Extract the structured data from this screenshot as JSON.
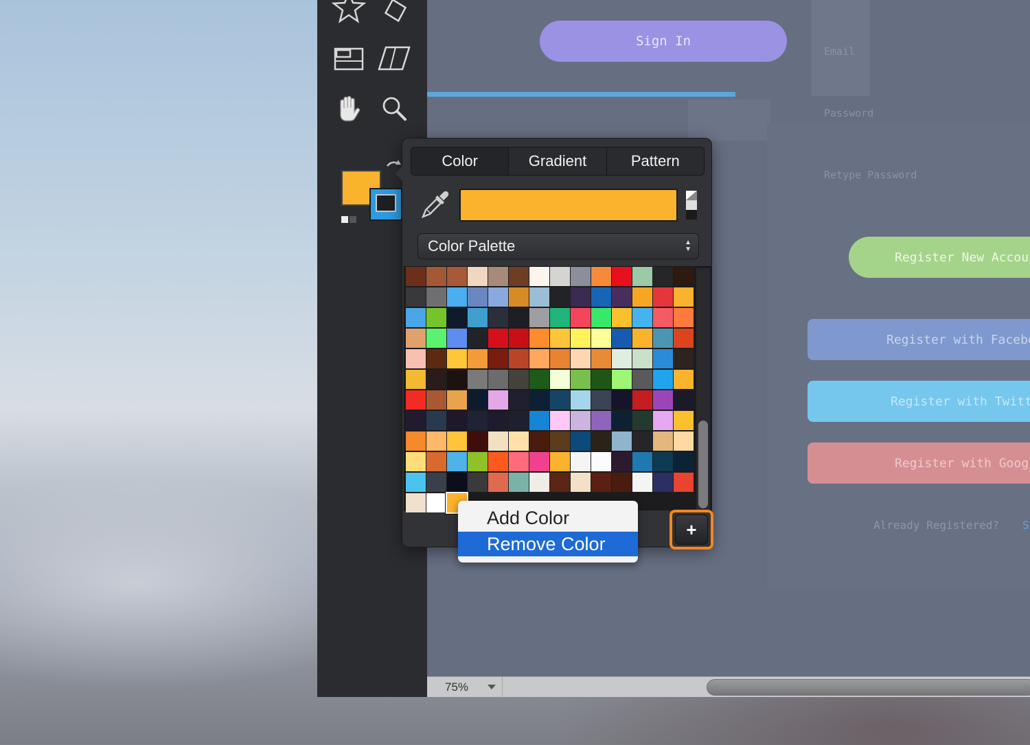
{
  "canvas_mockup": {
    "sign_in_label": "Sign In",
    "email_label": "Email",
    "password_label": "Password",
    "retype_password_label": "Retype Password",
    "register_new_account": "Register New Account",
    "register_facebook": "Register with Facebook",
    "register_twitter": "Register with Twitter",
    "register_google": "Register with Google",
    "already_registered": "Already Registered?",
    "sign_in_link": "S"
  },
  "status_bar": {
    "zoom": "75%"
  },
  "tools": [
    {
      "icon": "star-tool-icon"
    },
    {
      "icon": "diamond-tool-icon"
    },
    {
      "icon": "frame-tool-icon"
    },
    {
      "icon": "parallelogram-tool-icon"
    },
    {
      "icon": "hand-tool-icon"
    },
    {
      "icon": "zoom-tool-icon"
    }
  ],
  "color_popup": {
    "tabs": [
      "Color",
      "Gradient",
      "Pattern"
    ],
    "active_tab": "Color",
    "current_color": "#fbb22c",
    "palette_select": "Color Palette",
    "add_button_label": "+",
    "palette_colors": [
      [
        "#6b2f1a",
        "#a35a34",
        "#a8593a",
        "#f0d7bf",
        "#a88a7a",
        "#6e3e24",
        "#fbf5ee",
        "#d6d4d2",
        "#8b8f99",
        "#f58a3b",
        "#e8101e",
        "#9cc9a6",
        "#262629",
        "#2f1a10"
      ],
      [
        "#39393c",
        "#6f6f72",
        "#4aaeef",
        "#6a87c2",
        "#8aaadf",
        "#d88b24",
        "#9cbdd6",
        "#222326",
        "#3b2b52",
        "#1765b7",
        "#482e5e",
        "#f6a623",
        "#e5363c",
        "#fbb22c"
      ],
      [
        "#4aa6e6",
        "#73c52a",
        "#0f1a2a",
        "#3fa0d0",
        "#2a2f3b",
        "#1e1e25",
        "#9e9ea3",
        "#1fb57b",
        "#f4465a",
        "#37e86b",
        "#fbc02d",
        "#45b3f0",
        "#f55b64",
        "#ff7a3d"
      ],
      [
        "#e2a06d",
        "#5af36f",
        "#5f8cef",
        "#222326",
        "#d60f1c",
        "#c80f16",
        "#ff8c2c",
        "#ffc53a",
        "#fff25a",
        "#ffff9a",
        "#165bb0",
        "#fbb22c",
        "#4c96b4",
        "#dc4420"
      ],
      [
        "#f7c0b0",
        "#5c2a10",
        "#ffc63a",
        "#f39a3a",
        "#7a1c12",
        "#b94427",
        "#ffa75e",
        "#e98331",
        "#fed7b0",
        "#e98b36",
        "#dfeedf",
        "#c9e0c9",
        "#2a8cd8",
        "#2d231f"
      ],
      [
        "#f2b933",
        "#2a1c1a",
        "#1c1310",
        "#7a7a7c",
        "#6c6c6e",
        "#45423e",
        "#1e5a18",
        "#f4fed8",
        "#78c04a",
        "#1f5615",
        "#9ef576",
        "#5a5a5c",
        "#22a4ec",
        "#fbb22c"
      ],
      [
        "#f22c25",
        "#a85833",
        "#e8a34b",
        "#0e1b2e",
        "#e4a8e8",
        "#1f1f2f",
        "#0e2033",
        "#154566",
        "#a5d5ea",
        "#3a4454",
        "#14142a",
        "#c41d22",
        "#9b46b8",
        "#1a1a28"
      ],
      [
        "#221a2e",
        "#283a4e",
        "#1e182a",
        "#1f2334",
        "#1e1b2c",
        "#1e2030",
        "#1586d6",
        "#ffc8f8",
        "#cbb4e0",
        "#8e65bb",
        "#0c2233",
        "#253a2e",
        "#e6a8f0",
        "#fbc02d"
      ],
      [
        "#f5892b",
        "#ffb76a",
        "#ffc43a",
        "#3f0e0c",
        "#f3e0c0",
        "#ffe0a8",
        "#4a1c0e",
        "#5c3c1c",
        "#0c4a7a",
        "#2a2418",
        "#8fb4ce",
        "#262629",
        "#e3b77d",
        "#ffd8a3"
      ],
      [
        "#ffdd7a",
        "#d8692f",
        "#4fb2e8",
        "#8ec226",
        "#fe5a1d",
        "#ff6b7a",
        "#f0418f",
        "#fbb22c",
        "#f5f5f5",
        "#fcfcfc",
        "#2d1a2f",
        "#1f78b0",
        "#0f3a54",
        "#0c2236"
      ],
      [
        "#4ac4ee",
        "#3a3f4c",
        "#0c0e1c",
        "#3a3a3d",
        "#e06a50",
        "#7ab2a8",
        "#f0ece6",
        "#5c2614",
        "#f4e0c6",
        "#5a2012",
        "#4a1c10",
        "#f4f4f4",
        "#2c2f62",
        "#e8442f"
      ],
      [
        "#f0e0cc",
        "#ffffff",
        "#fbb22c"
      ]
    ]
  },
  "context_menu": {
    "items": [
      "Add Color",
      "Remove Color"
    ],
    "selected_index": 1
  }
}
